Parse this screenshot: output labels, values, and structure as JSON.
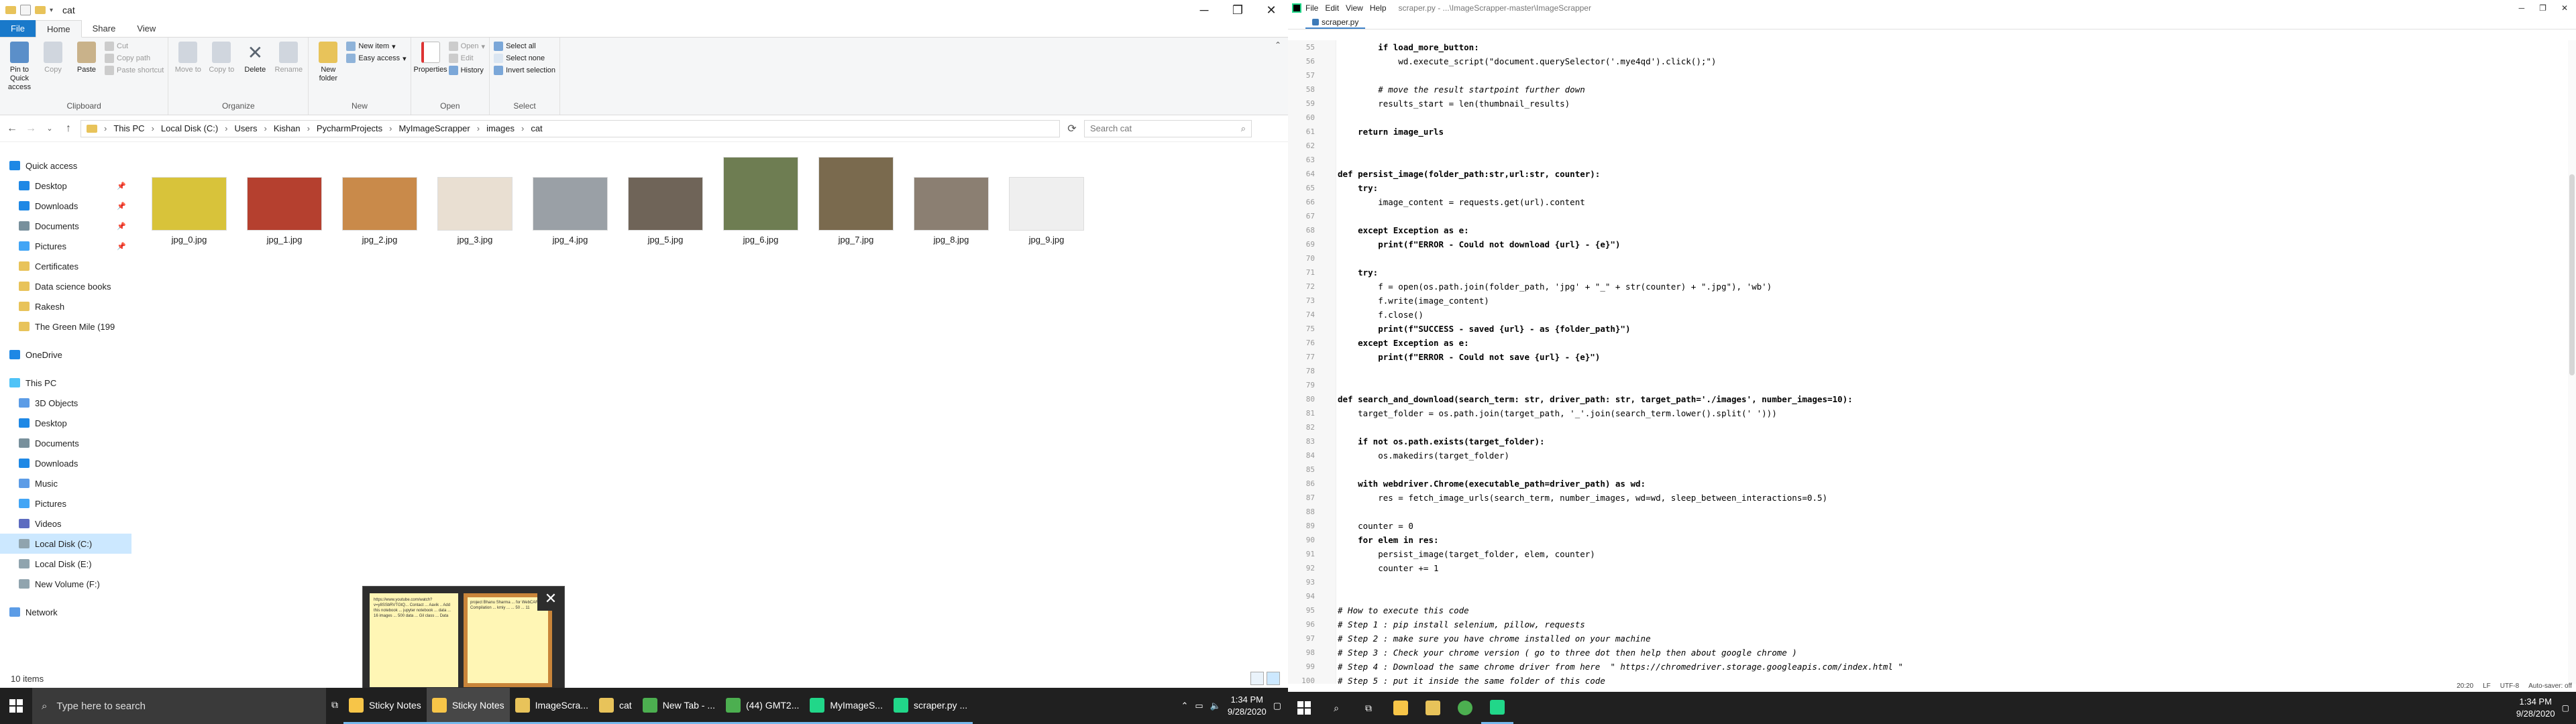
{
  "explorer": {
    "title": "cat",
    "ribbon_tabs": [
      "File",
      "Home",
      "Share",
      "View"
    ],
    "clipboard": {
      "pin": "Pin to Quick access",
      "copy": "Copy",
      "paste": "Paste",
      "cut": "Cut",
      "copy_path": "Copy path",
      "paste_shortcut": "Paste shortcut",
      "group": "Clipboard"
    },
    "organize": {
      "move_to": "Move to",
      "copy_to": "Copy to",
      "delete": "Delete",
      "rename": "Rename",
      "group": "Organize"
    },
    "new": {
      "new_folder": "New folder",
      "new_item": "New item",
      "easy_access": "Easy access",
      "group": "New"
    },
    "open": {
      "properties": "Properties",
      "open": "Open",
      "edit": "Edit",
      "history": "History",
      "group": "Open"
    },
    "select": {
      "select_all": "Select all",
      "select_none": "Select none",
      "invert": "Invert selection",
      "group": "Select"
    },
    "breadcrumb": [
      "This PC",
      "Local Disk (C:)",
      "Users",
      "Kishan",
      "PycharmProjects",
      "MyImageScrapper",
      "images",
      "cat"
    ],
    "search_placeholder": "Search cat",
    "nav": [
      {
        "label": "Quick access",
        "level": 0,
        "color": "#1e88e5",
        "pinned": false
      },
      {
        "label": "Desktop",
        "level": 1,
        "color": "#1e88e5",
        "pinned": true
      },
      {
        "label": "Downloads",
        "level": 1,
        "color": "#1e88e5",
        "pinned": true
      },
      {
        "label": "Documents",
        "level": 1,
        "color": "#78909c",
        "pinned": true
      },
      {
        "label": "Pictures",
        "level": 1,
        "color": "#42a5f5",
        "pinned": true
      },
      {
        "label": "Certificates",
        "level": 1,
        "color": "#e8c35a",
        "pinned": false
      },
      {
        "label": "Data science books",
        "level": 1,
        "color": "#e8c35a",
        "pinned": false
      },
      {
        "label": "Rakesh",
        "level": 1,
        "color": "#e8c35a",
        "pinned": false
      },
      {
        "label": "The Green Mile (199",
        "level": 1,
        "color": "#e8c35a",
        "pinned": false
      },
      {
        "label": "",
        "level": 0,
        "color": "",
        "pinned": false
      },
      {
        "label": "OneDrive",
        "level": 0,
        "color": "#1e88e5",
        "pinned": false
      },
      {
        "label": "",
        "level": 0,
        "color": "",
        "pinned": false
      },
      {
        "label": "This PC",
        "level": 0,
        "color": "#4fc3f7",
        "pinned": false
      },
      {
        "label": "3D Objects",
        "level": 1,
        "color": "#5c9ce6",
        "pinned": false
      },
      {
        "label": "Desktop",
        "level": 1,
        "color": "#1e88e5",
        "pinned": false
      },
      {
        "label": "Documents",
        "level": 1,
        "color": "#78909c",
        "pinned": false
      },
      {
        "label": "Downloads",
        "level": 1,
        "color": "#1e88e5",
        "pinned": false
      },
      {
        "label": "Music",
        "level": 1,
        "color": "#5c9ce6",
        "pinned": false
      },
      {
        "label": "Pictures",
        "level": 1,
        "color": "#42a5f5",
        "pinned": false
      },
      {
        "label": "Videos",
        "level": 1,
        "color": "#5c6bc0",
        "pinned": false
      },
      {
        "label": "Local Disk (C:)",
        "level": 1,
        "color": "#90a4ae",
        "pinned": false,
        "selected": true
      },
      {
        "label": "Local Disk (E:)",
        "level": 1,
        "color": "#90a4ae",
        "pinned": false
      },
      {
        "label": "New Volume (F:)",
        "level": 1,
        "color": "#90a4ae",
        "pinned": false
      },
      {
        "label": "",
        "level": 0,
        "color": "",
        "pinned": false
      },
      {
        "label": "Network",
        "level": 0,
        "color": "#5c9ce6",
        "pinned": false
      }
    ],
    "files": [
      {
        "name": "jpg_0.jpg",
        "color": "#d8c33a",
        "tall": false
      },
      {
        "name": "jpg_1.jpg",
        "color": "#b5402f",
        "tall": false
      },
      {
        "name": "jpg_2.jpg",
        "color": "#c98a4a",
        "tall": false
      },
      {
        "name": "jpg_3.jpg",
        "color": "#e9dfd2",
        "tall": false
      },
      {
        "name": "jpg_4.jpg",
        "color": "#9aa0a6",
        "tall": false
      },
      {
        "name": "jpg_5.jpg",
        "color": "#6f6458",
        "tall": false
      },
      {
        "name": "jpg_6.jpg",
        "color": "#6e7d52",
        "tall": true
      },
      {
        "name": "jpg_7.jpg",
        "color": "#7a6a4e",
        "tall": true
      },
      {
        "name": "jpg_8.jpg",
        "color": "#8b7f72",
        "tall": false
      },
      {
        "name": "jpg_9.jpg",
        "color": "#efefef",
        "tall": false
      }
    ],
    "status": "10 items"
  },
  "sticky_preview": {
    "note1": "https://www.youtube.com/watch?v=y8SSbRVTGtQ... Contact ... Aavik .. Add this notebook ... jupyter notebook ... data ... 16 images ... 500 data ... Gil class ... Data",
    "note2": "project Bhanu Sharma ... for WebCAR Compilation ... kmiy ... ... 50 ... 11"
  },
  "taskbar": {
    "search_placeholder": "Type here to search",
    "apps": [
      {
        "label": "Sticky Notes",
        "color": "#f7c548",
        "state": "open"
      },
      {
        "label": "Sticky Notes",
        "color": "#f7c548",
        "state": "active"
      },
      {
        "label": "ImageScra...",
        "color": "#e8c35a",
        "state": "open"
      },
      {
        "label": "cat",
        "color": "#e8c35a",
        "state": "open"
      },
      {
        "label": "New Tab - ...",
        "color": "#4caf50",
        "state": "open"
      },
      {
        "label": "(44) GMT2...",
        "color": "#4caf50",
        "state": "open"
      },
      {
        "label": "MyImageS...",
        "color": "#21d789",
        "state": "open"
      },
      {
        "label": "scraper.py ...",
        "color": "#21d789",
        "state": "open"
      }
    ],
    "time": "1:34 PM",
    "date": "9/28/2020"
  },
  "editor": {
    "menu": [
      "File",
      "Edit",
      "View",
      "Help"
    ],
    "title": "scraper.py - ...\\ImageScrapper-master\\ImageScrapper",
    "tab": "scraper.py",
    "lines": [
      {
        "n": "55",
        "t": "        if load_more_button:",
        "c": "kw"
      },
      {
        "n": "56",
        "t": "            wd.execute_script(\"document.querySelector('.mye4qd').click();\")",
        "c": ""
      },
      {
        "n": "57",
        "t": "",
        "c": ""
      },
      {
        "n": "58",
        "t": "        # move the result startpoint further down",
        "c": "com"
      },
      {
        "n": "59",
        "t": "        results_start = len(thumbnail_results)",
        "c": ""
      },
      {
        "n": "60",
        "t": "",
        "c": ""
      },
      {
        "n": "61",
        "t": "    return image_urls",
        "c": "kw"
      },
      {
        "n": "62",
        "t": "",
        "c": ""
      },
      {
        "n": "63",
        "t": "",
        "c": ""
      },
      {
        "n": "64",
        "t": "def persist_image(folder_path:str,url:str, counter):",
        "c": "kw"
      },
      {
        "n": "65",
        "t": "    try:",
        "c": "kw"
      },
      {
        "n": "66",
        "t": "        image_content = requests.get(url).content",
        "c": ""
      },
      {
        "n": "67",
        "t": "",
        "c": ""
      },
      {
        "n": "68",
        "t": "    except Exception as e:",
        "c": "kw"
      },
      {
        "n": "69",
        "t": "        print(f\"ERROR - Could not download {url} - {e}\")",
        "c": "str"
      },
      {
        "n": "70",
        "t": "",
        "c": ""
      },
      {
        "n": "71",
        "t": "    try:",
        "c": "kw"
      },
      {
        "n": "72",
        "t": "        f = open(os.path.join(folder_path, 'jpg' + \"_\" + str(counter) + \".jpg\"), 'wb')",
        "c": ""
      },
      {
        "n": "73",
        "t": "        f.write(image_content)",
        "c": ""
      },
      {
        "n": "74",
        "t": "        f.close()",
        "c": ""
      },
      {
        "n": "75",
        "t": "        print(f\"SUCCESS - saved {url} - as {folder_path}\")",
        "c": "str"
      },
      {
        "n": "76",
        "t": "    except Exception as e:",
        "c": "kw"
      },
      {
        "n": "77",
        "t": "        print(f\"ERROR - Could not save {url} - {e}\")",
        "c": "str"
      },
      {
        "n": "78",
        "t": "",
        "c": ""
      },
      {
        "n": "79",
        "t": "",
        "c": ""
      },
      {
        "n": "80",
        "t": "def search_and_download(search_term: str, driver_path: str, target_path='./images', number_images=10):",
        "c": "kw"
      },
      {
        "n": "81",
        "t": "    target_folder = os.path.join(target_path, '_'.join(search_term.lower().split(' ')))",
        "c": ""
      },
      {
        "n": "82",
        "t": "",
        "c": ""
      },
      {
        "n": "83",
        "t": "    if not os.path.exists(target_folder):",
        "c": "kw"
      },
      {
        "n": "84",
        "t": "        os.makedirs(target_folder)",
        "c": ""
      },
      {
        "n": "85",
        "t": "",
        "c": ""
      },
      {
        "n": "86",
        "t": "    with webdriver.Chrome(executable_path=driver_path) as wd:",
        "c": "kw"
      },
      {
        "n": "87",
        "t": "        res = fetch_image_urls(search_term, number_images, wd=wd, sleep_between_interactions=0.5)",
        "c": ""
      },
      {
        "n": "88",
        "t": "",
        "c": ""
      },
      {
        "n": "89",
        "t": "    counter = 0",
        "c": ""
      },
      {
        "n": "90",
        "t": "    for elem in res:",
        "c": "kw"
      },
      {
        "n": "91",
        "t": "        persist_image(target_folder, elem, counter)",
        "c": ""
      },
      {
        "n": "92",
        "t": "        counter += 1",
        "c": ""
      },
      {
        "n": "93",
        "t": "",
        "c": ""
      },
      {
        "n": "94",
        "t": "",
        "c": ""
      },
      {
        "n": "95",
        "t": "# How to execute this code",
        "c": "com"
      },
      {
        "n": "96",
        "t": "# Step 1 : pip install selenium, pillow, requests",
        "c": "com"
      },
      {
        "n": "97",
        "t": "# Step 2 : make sure you have chrome installed on your machine",
        "c": "com"
      },
      {
        "n": "98",
        "t": "# Step 3 : Check your chrome version ( go to three dot then help then about google chrome )",
        "c": "com"
      },
      {
        "n": "99",
        "t": "# Step 4 : Download the same chrome driver from here  \" https://chromedriver.storage.googleapis.com/index.html \"",
        "c": "com"
      },
      {
        "n": "100",
        "t": "# Step 5 : put it inside the same folder of this code",
        "c": "com"
      }
    ],
    "status": [
      "20:20",
      "LF",
      "UTF-8",
      "Auto-saver: off"
    ]
  },
  "taskbar2": {
    "time": "1:34 PM",
    "date": "9/28/2020"
  }
}
